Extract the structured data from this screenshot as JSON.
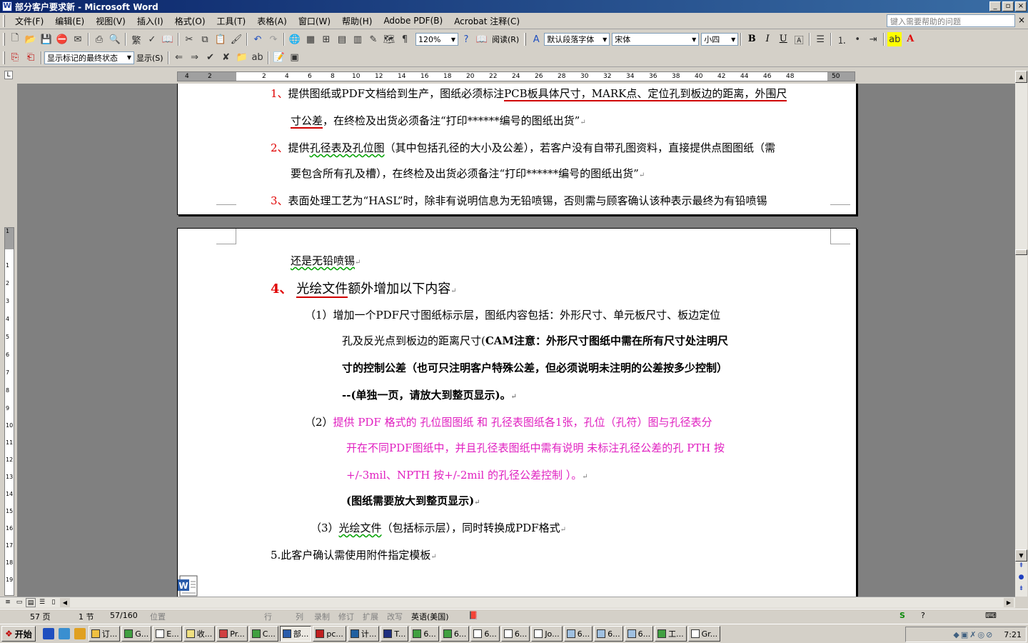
{
  "window": {
    "title": "部分客户要求新 - Microsoft Word",
    "controls": [
      "_",
      "▫",
      "×"
    ]
  },
  "menu": {
    "items": [
      "文件(F)",
      "编辑(E)",
      "视图(V)",
      "插入(I)",
      "格式(O)",
      "工具(T)",
      "表格(A)",
      "窗口(W)",
      "帮助(H)",
      "Adobe PDF(B)",
      "Acrobat 注释(C)"
    ],
    "help_placeholder": "键入需要帮助的问题"
  },
  "toolbar": {
    "zoom": "120%",
    "read_label": "阅读(R)",
    "style": "默认段落字体",
    "font": "宋体",
    "size": "小四",
    "bold": "B",
    "italic": "I",
    "underline": "U",
    "font_color_label": "A",
    "reviewing_state": "显示标记的最终状态",
    "show_label": "显示(S)",
    "trad_simp": "繁"
  },
  "ruler": {
    "labels": [
      "4",
      "2",
      "2",
      "4",
      "6",
      "8",
      "10",
      "12",
      "14",
      "16",
      "18",
      "20",
      "22",
      "24",
      "26",
      "28",
      "30",
      "32",
      "34",
      "36",
      "38",
      "40",
      "42",
      "44",
      "46",
      "48",
      "50"
    ],
    "vlabels": [
      "1",
      "1",
      "2",
      "3",
      "4",
      "5",
      "6",
      "7",
      "8",
      "9",
      "10",
      "11",
      "12",
      "13",
      "14",
      "15",
      "16",
      "17",
      "18",
      "19"
    ]
  },
  "document": {
    "page1": [
      {
        "num": "1、",
        "text_a": "提供图纸或PDF文档给到生产，图纸必须标注",
        "text_b": "PCB板具体尺寸，MARK点、定位孔到板边的距离，外围尺"
      },
      {
        "text_c": "寸公差",
        "text_d": "，在终检及出货必须备注“打印******编号的图纸出货”"
      },
      {
        "num": "2、",
        "text_a": "提供",
        "text_b": "孔径表及孔位图",
        "text_c": "（其中包括孔径的大小及公差），若客户没有自带孔图资料，直接提供点图图纸（需"
      },
      {
        "text_a": "要包含所有孔及槽），在终检及出货必须备注“打印******编号的图纸出货”"
      },
      {
        "num": "3、",
        "text_a": "表面处理工艺为“HASL”时，除非有说明信息为无铅喷锡，否则需与顾客确认该种表示最终为有铅喷锡"
      }
    ],
    "page2": {
      "line1": "还是无铅喷锡",
      "item4_num": "4、",
      "item4_underlined": "光绘文件",
      "item4_rest": "额外增加以下内容",
      "sub1_a": "（1）增加一个PDF尺寸图纸标示层，图纸内容包括：外形尺寸、单元板尺寸、板边定位",
      "sub1_b_plain": "孔及反光点到板边的距离尺寸(",
      "sub1_b_bold": "CAM注意：外形尺寸图纸中需在所有尺寸处注明尺",
      "sub1_c": "寸的控制公差（也可只注明客户特殊公差，但必须说明未注明的公差按多少控制）",
      "sub1_d": "--(单独一页，请放大到整页显示)。",
      "sub2_num": "（2）",
      "sub2_a": "提供 PDF 格式的 孔位图图纸 和 孔径表图纸各1张，孔位（孔符）图与孔径表分",
      "sub2_b": "开在不同PDF图纸中，并且孔径表图纸中需有说明 未标注孔径公差的孔 PTH 按",
      "sub2_c": "+/-3mil、NPTH 按+/-2mil 的孔径公差控制  ）。",
      "sub2_d": "(图纸需要放大到整页显示)",
      "sub3_a": "（3）",
      "sub3_underlined": "光绘文件",
      "sub3_b": "（包括标示层），同时转换成PDF格式",
      "item5": "5.此客户确认需使用附件指定模板",
      "para_mark": "↵"
    }
  },
  "status": {
    "page": "57 页",
    "section": "1 节",
    "pages": "57/160",
    "position": "位置",
    "line": "行",
    "col": "列",
    "rec": "录制",
    "trk": "修订",
    "ext": "扩展",
    "ovr": "改写",
    "lang": "英语(美国)"
  },
  "taskbar": {
    "start": "开始",
    "tasks": [
      "订...",
      "G...",
      "E...",
      "收...",
      "Pr...",
      "C...",
      "部...",
      "pc...",
      "计...",
      "T...",
      "6...",
      "6...",
      "6...",
      "6...",
      "Jo...",
      "6...",
      "6...",
      "6...",
      "工...",
      "Gr..."
    ],
    "active_index": 6,
    "clock": "7:21"
  },
  "colors": {
    "title_start": "#0a246a",
    "title_end": "#3a6ea5",
    "red": "#e00000",
    "magenta": "#e020c0",
    "doc_bg": "#808080",
    "chrome": "#d4d0c8"
  }
}
